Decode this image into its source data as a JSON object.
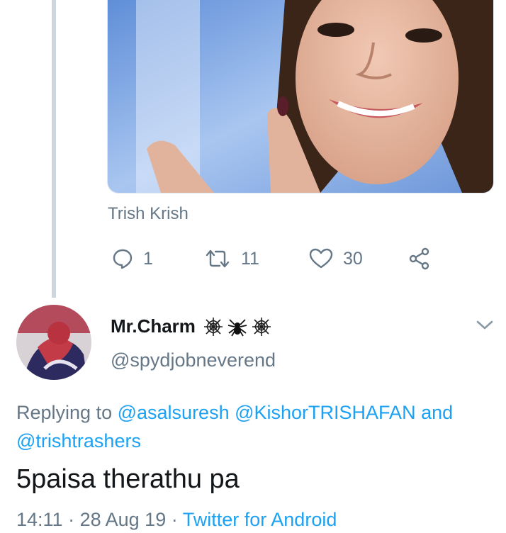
{
  "quoted_tweet": {
    "caption": "Trish Krish",
    "actions": {
      "reply_count": "1",
      "retweet_count": "11",
      "like_count": "30"
    }
  },
  "reply": {
    "display_name": "Mr.Charm",
    "name_emojis": [
      "spiderweb-emoji",
      "spider-emoji",
      "spiderweb-emoji"
    ],
    "handle": "@spydjobneverend",
    "replying_prefix": "Replying to",
    "replying_to": [
      "@asalsuresh",
      "@KishorTRISHAFAN",
      "@trishtrashers"
    ],
    "replying_joiner": "and",
    "text": "5paisa therathu pa",
    "time": "14:11",
    "separator": "·",
    "date": "28 Aug 19",
    "source": "Twitter for Android"
  },
  "colors": {
    "text_primary": "#14171a",
    "text_secondary": "#657786",
    "link": "#1da1f2",
    "thread_line": "#cdd6dd"
  }
}
